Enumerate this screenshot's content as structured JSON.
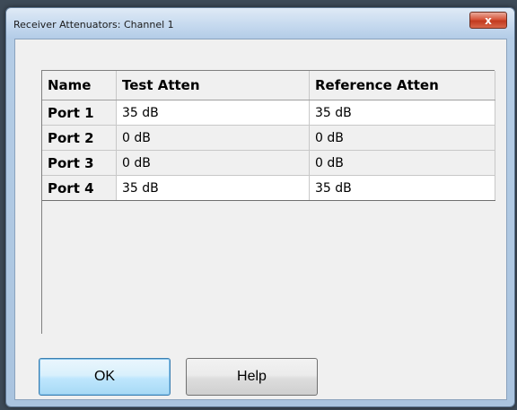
{
  "window": {
    "title": "Receiver Attenuators: Channel 1",
    "close_glyph": "x"
  },
  "table": {
    "headers": [
      "Name",
      "Test Atten",
      "Reference Atten"
    ],
    "rows": [
      {
        "name": "Port 1",
        "test": "35 dB",
        "reference": "35 dB"
      },
      {
        "name": "Port 2",
        "test": "0 dB",
        "reference": "0 dB"
      },
      {
        "name": "Port 3",
        "test": "0 dB",
        "reference": "0 dB"
      },
      {
        "name": "Port 4",
        "test": "35 dB",
        "reference": "35 dB"
      }
    ]
  },
  "buttons": {
    "ok_label": "OK",
    "help_label": "Help"
  },
  "icons": {
    "close": "close-icon"
  }
}
